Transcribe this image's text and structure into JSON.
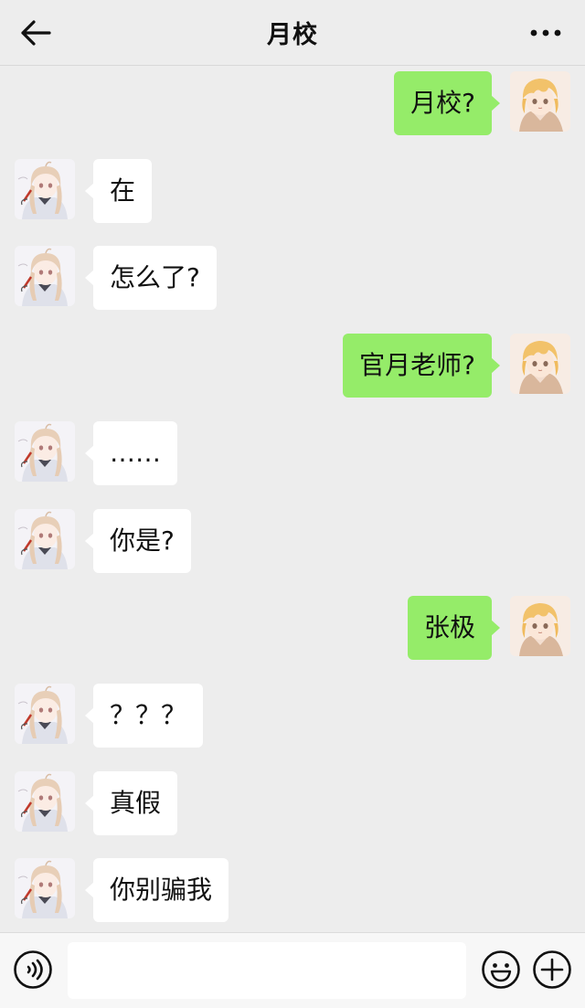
{
  "header": {
    "title": "月校",
    "back_icon": "arrow-left-icon",
    "more_icon": "more-dots-icon"
  },
  "colors": {
    "background": "#ededed",
    "self_bubble": "#95ec69",
    "other_bubble": "#ffffff"
  },
  "messages": [
    {
      "sender": "self",
      "text": "月校?"
    },
    {
      "sender": "other",
      "text": "在"
    },
    {
      "sender": "other",
      "text": "怎么了?"
    },
    {
      "sender": "self",
      "text": "官月老师?"
    },
    {
      "sender": "other",
      "text": "……"
    },
    {
      "sender": "other",
      "text": "你是?"
    },
    {
      "sender": "self",
      "text": "张极"
    },
    {
      "sender": "other",
      "text": "？？？"
    },
    {
      "sender": "other",
      "text": "真假"
    },
    {
      "sender": "other",
      "text": "你别骗我"
    }
  ],
  "input_bar": {
    "value": "",
    "voice_icon": "voice-icon",
    "emoji_icon": "emoji-icon",
    "plus_icon": "plus-circle-icon"
  }
}
